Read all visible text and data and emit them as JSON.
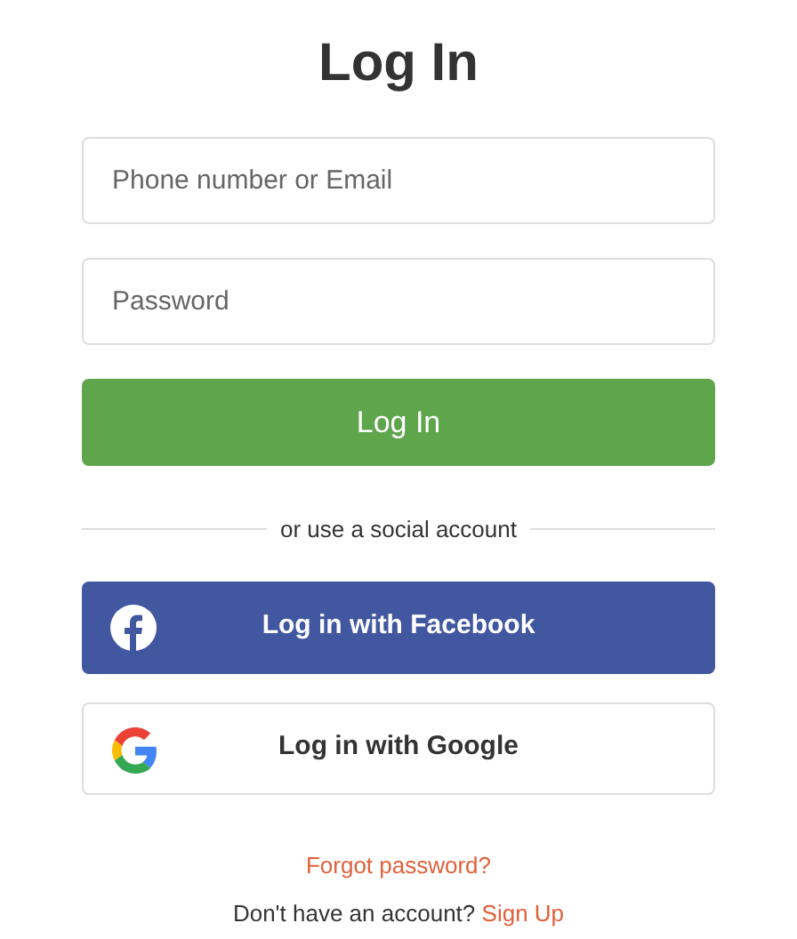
{
  "title": "Log In",
  "fields": [
    {
      "placeholder": "Phone number or Email"
    },
    {
      "placeholder": "Password"
    }
  ],
  "submit": "Log In",
  "divider": "or use a social account",
  "social": [
    {
      "kind": "facebook",
      "label": "Log in with Facebook"
    },
    {
      "kind": "google",
      "label": "Log in with Google"
    }
  ],
  "forgot": "Forgot password?",
  "signup": {
    "prompt": "Don't have an account?",
    "link": "Sign Up"
  }
}
